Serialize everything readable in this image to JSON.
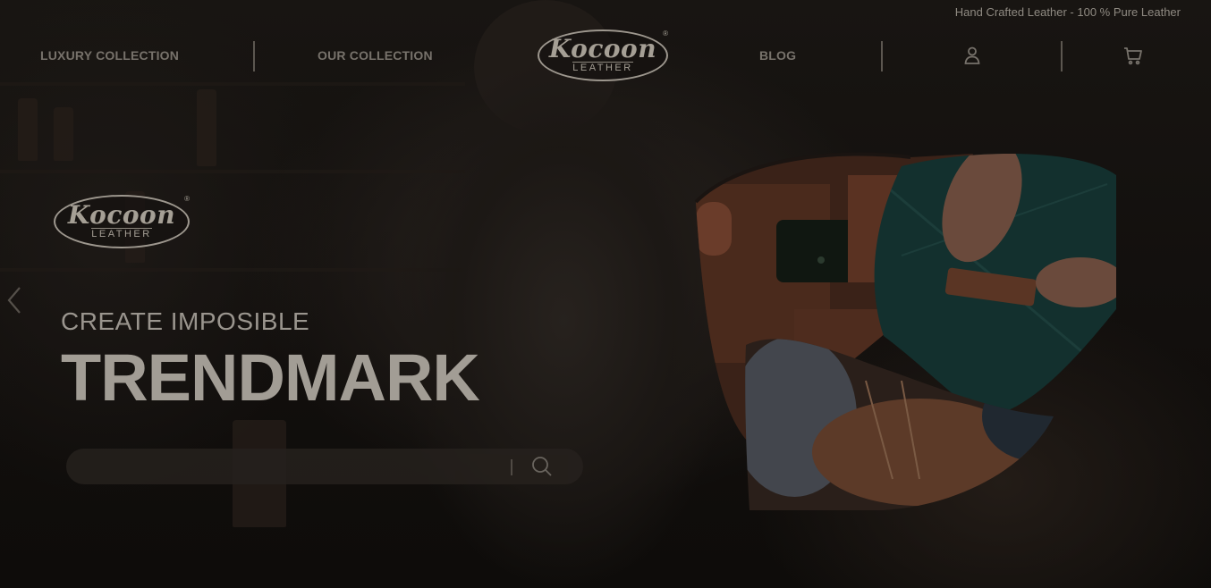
{
  "topbar": {
    "tagline": "Hand Crafted Leather - 100 % Pure Leather"
  },
  "nav": {
    "luxury_label": "LUXURY COLLECTION",
    "collection_label": "OUR COLLECTION",
    "blog_label": "BLOG",
    "account_icon": "user-icon",
    "cart_icon": "cart-icon"
  },
  "logo": {
    "brand": "Kocoon",
    "sub": "LEATHER",
    "reg": "®"
  },
  "hero": {
    "kicker": "CREATE IMPOSIBLE",
    "title": "TRENDMARK",
    "prev_icon": "chevron-left-icon"
  },
  "search": {
    "value": "",
    "icon": "search-icon"
  },
  "colors": {
    "overlay": "#0f0d0b",
    "muted_text": "#77726b",
    "accent_leather": "#6b3b28"
  }
}
